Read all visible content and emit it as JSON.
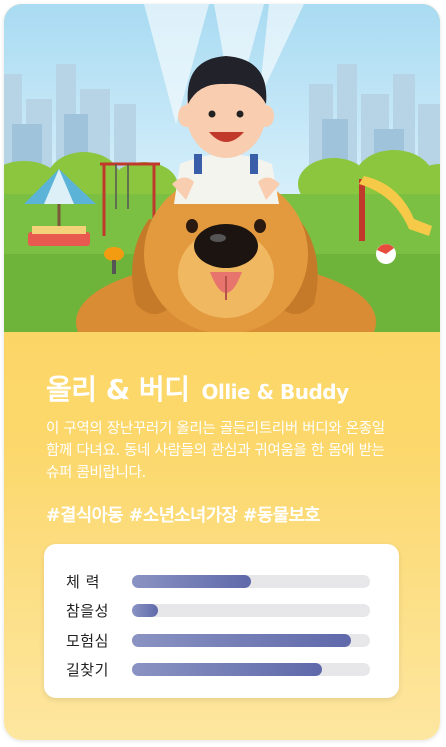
{
  "profile": {
    "name_ko": "올리 & 버디",
    "name_en": "Ollie & Buddy",
    "description": "이 구역의 장난꾸러기 올리는 골든리트리버 버디와 온종일 함께 다녀요. 동네 사람들의 관심과 귀여움을 한 몸에 받는 슈퍼 콤비랍니다.",
    "tags": "#결식아동 #소년소녀가장 #동물보호"
  },
  "stats": [
    {
      "label": "체  력",
      "value": 0.5
    },
    {
      "label": "참을성",
      "value": 0.11
    },
    {
      "label": "모험심",
      "value": 0.92
    },
    {
      "label": "길찾기",
      "value": 0.8
    }
  ],
  "colors": {
    "card_bg": "#f9cf55",
    "bar_fill": "#5f69aa",
    "bar_track": "#e7e7ea"
  }
}
